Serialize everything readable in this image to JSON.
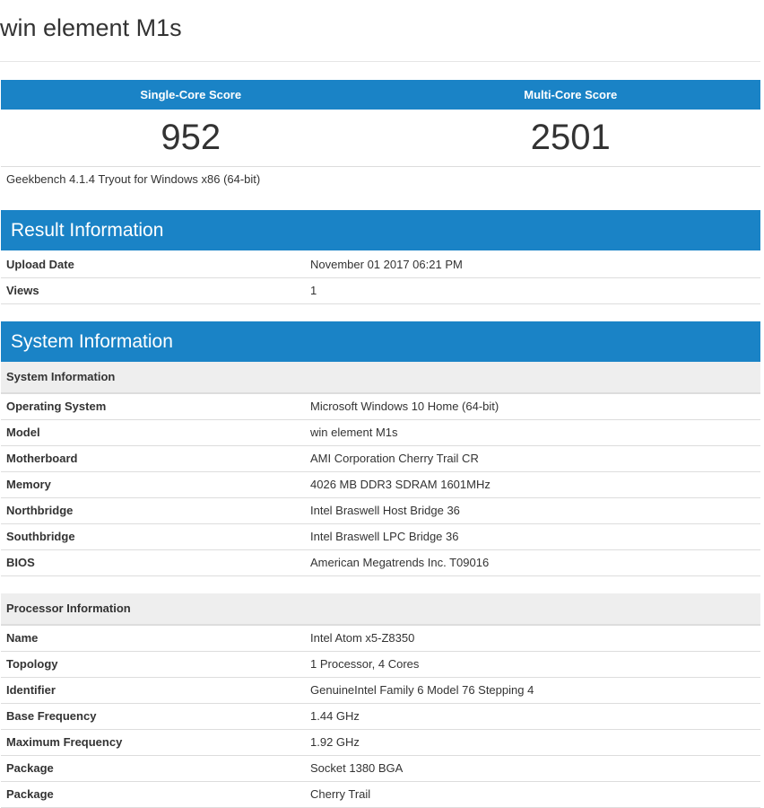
{
  "title": "win element M1s",
  "scores": {
    "single_label": "Single-Core Score",
    "multi_label": "Multi-Core Score",
    "single_value": "952",
    "multi_value": "2501"
  },
  "version": "Geekbench 4.1.4 Tryout for Windows x86 (64-bit)",
  "result_info": {
    "header": "Result Information",
    "rows": [
      {
        "key": "Upload Date",
        "value": "November 01 2017 06:21 PM"
      },
      {
        "key": "Views",
        "value": "1"
      }
    ]
  },
  "system_info": {
    "header": "System Information",
    "system_subheader": "System Information",
    "system_rows": [
      {
        "key": "Operating System",
        "value": "Microsoft Windows 10 Home (64-bit)"
      },
      {
        "key": "Model",
        "value": "win element M1s"
      },
      {
        "key": "Motherboard",
        "value": "AMI Corporation Cherry Trail CR"
      },
      {
        "key": "Memory",
        "value": "4026 MB DDR3 SDRAM 1601MHz"
      },
      {
        "key": "Northbridge",
        "value": "Intel Braswell Host Bridge 36"
      },
      {
        "key": "Southbridge",
        "value": "Intel Braswell LPC Bridge 36"
      },
      {
        "key": "BIOS",
        "value": "American Megatrends Inc. T09016"
      }
    ],
    "processor_subheader": "Processor Information",
    "processor_rows": [
      {
        "key": "Name",
        "value": "Intel Atom x5-Z8350"
      },
      {
        "key": "Topology",
        "value": "1 Processor, 4 Cores"
      },
      {
        "key": "Identifier",
        "value": "GenuineIntel Family 6 Model 76 Stepping 4"
      },
      {
        "key": "Base Frequency",
        "value": "1.44 GHz"
      },
      {
        "key": "Maximum Frequency",
        "value": "1.92 GHz"
      },
      {
        "key": "Package",
        "value": "Socket 1380 BGA"
      },
      {
        "key": "Package",
        "value": "Cherry Trail"
      }
    ]
  },
  "colors": {
    "accent": "#1a83c6",
    "subheader_bg": "#eeeeee",
    "border": "#dddddd"
  }
}
